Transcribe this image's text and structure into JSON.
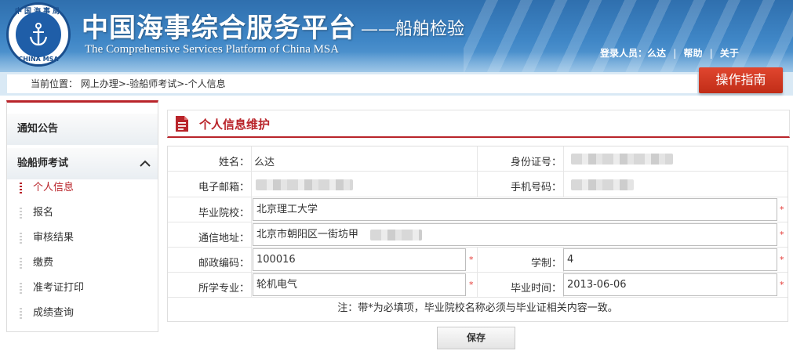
{
  "header": {
    "logo_text_top": "中国海事局",
    "logo_text_bottom": "CHINA MSA",
    "title_cn": "中国海事综合服务平台",
    "title_sub": "——船舶检验",
    "title_en": "The Comprehensive Services Platform of China MSA",
    "user_label": "登录人员：么达",
    "help_link": "帮助",
    "about_link": "关于",
    "separator": "|"
  },
  "breadcrumb": {
    "text": "当前位置： 网上办理>-验船师考试>-个人信息"
  },
  "guide_button": "操作指南",
  "sidebar": {
    "sections": [
      {
        "label": "通知公告"
      },
      {
        "label": "验船师考试"
      }
    ],
    "items": [
      {
        "label": "个人信息",
        "active": true
      },
      {
        "label": "报名"
      },
      {
        "label": "审核结果"
      },
      {
        "label": "缴费"
      },
      {
        "label": "准考证打印"
      },
      {
        "label": "成绩查询"
      }
    ]
  },
  "panel": {
    "title": "个人信息维护"
  },
  "form": {
    "name_label": "姓名：",
    "name_value": "么达",
    "id_label": "身份证号：",
    "email_label": "电子邮箱：",
    "phone_label": "手机号码：",
    "school_label": "毕业院校：",
    "school_value": "北京理工大学",
    "address_label": "通信地址：",
    "address_value": "北京市朝阳区一街坊甲",
    "zip_label": "邮政编码：",
    "zip_value": "100016",
    "duration_label": "学制：",
    "duration_value": "4",
    "major_label": "所学专业：",
    "major_value": "轮机电气",
    "grad_label": "毕业时间：",
    "grad_value": "2013-06-06",
    "required_mark": "*",
    "note": "注：带*为必填项，毕业院校名称必须与毕业证相关内容一致。"
  },
  "save_button": "保存",
  "colors": {
    "accent_red": "#b9242a",
    "header_blue": "#3f86c6",
    "required": "#e53935"
  }
}
